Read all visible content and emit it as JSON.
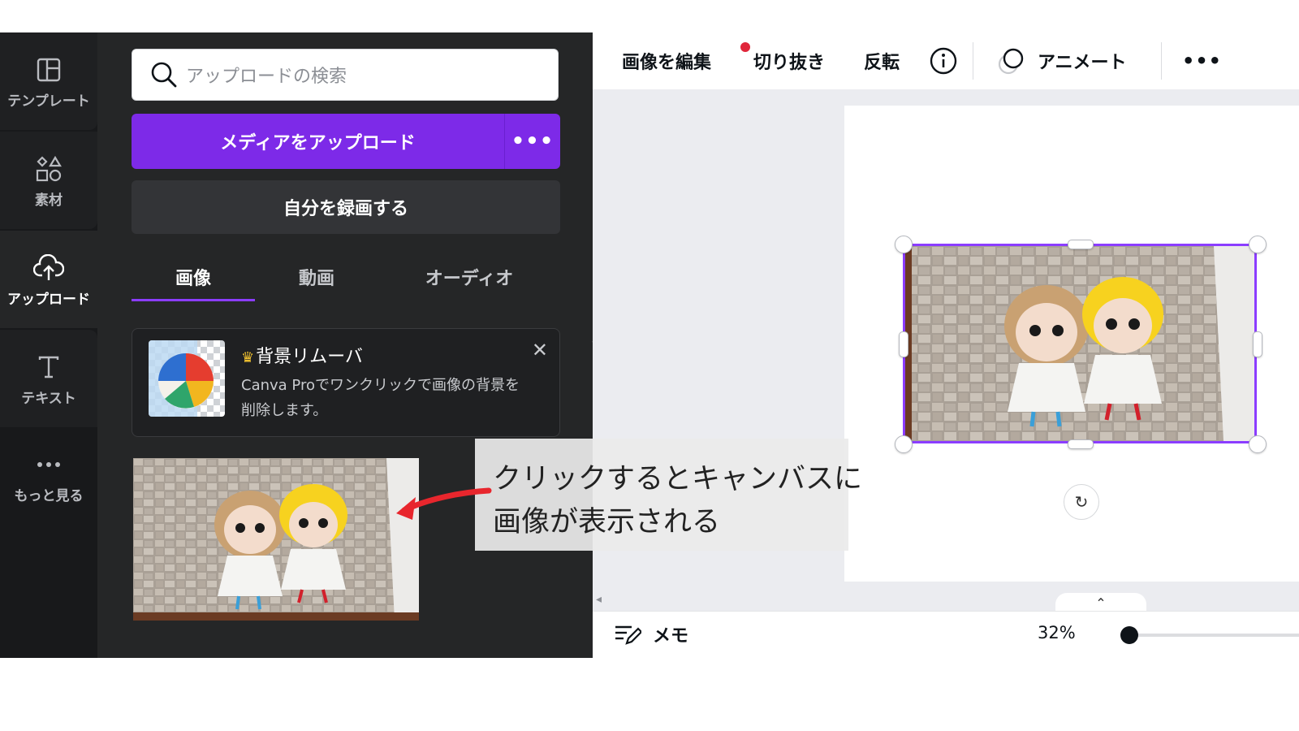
{
  "sidebar": {
    "items": [
      {
        "label": "テンプレート",
        "icon": "template-icon"
      },
      {
        "label": "素材",
        "icon": "elements-icon"
      },
      {
        "label": "アップロード",
        "icon": "upload-cloud-icon"
      },
      {
        "label": "テキスト",
        "icon": "text-icon"
      },
      {
        "label": "もっと見る",
        "icon": "more-dots-icon"
      }
    ],
    "active": "アップロード"
  },
  "panel": {
    "search": {
      "placeholder": "アップロードの検索",
      "value": ""
    },
    "upload_button": "メディアをアップロード",
    "upload_more": "•••",
    "record_button": "自分を録画する",
    "tabs": [
      {
        "label": "画像",
        "active": true
      },
      {
        "label": "動画",
        "active": false
      },
      {
        "label": "オーディオ",
        "active": false
      }
    ],
    "promo": {
      "crown": "♛",
      "title": "背景リムーバ",
      "description": "Canva Proでワンクリックで画像の背景を削除します。",
      "close": "✕"
    },
    "thumbnail": {
      "icon": "uploaded-image-thumbnail"
    }
  },
  "toolbar": {
    "edit_image": "画像を編集",
    "crop": "切り抜き",
    "flip": "反転",
    "info_icon": "info-icon",
    "animate": "アニメート",
    "more": "•••"
  },
  "bottom_bar": {
    "memo": "メモ",
    "zoom": "32%",
    "zoom_level": 0.32
  },
  "annotation": {
    "text": "クリックするとキャンバスに\n画像が表示される"
  },
  "colors": {
    "accent": "#8b3dff",
    "upload_button": "#7d2ae8",
    "panel_bg": "#252627",
    "rail_bg": "#18191b",
    "notification_dot": "#e0263a",
    "arrow": "#e8262d"
  }
}
